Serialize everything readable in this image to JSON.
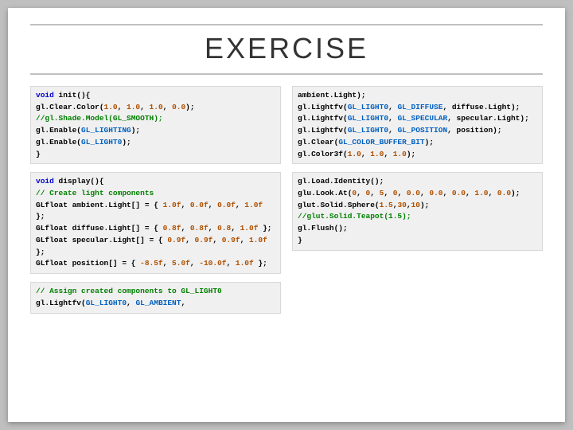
{
  "title": "EXERCISE",
  "code_left_1": {
    "l1a": "void",
    "l1b": " init(){",
    "l2a": "gl.Clear.Color(",
    "l2b": "1.0",
    "l2c": ", ",
    "l2d": "1.0",
    "l2e": ", ",
    "l2f": "1.0",
    "l2g": ", ",
    "l2h": "0.0",
    "l2i": ");",
    "l3": "//gl.Shade.Model(GL_SMOOTH);",
    "l4a": "gl.Enable(",
    "l4b": "GL_LIGHTING",
    "l4c": ");",
    "l5a": "gl.Enable(",
    "l5b": "GL_LIGHT0",
    "l5c": ");",
    "l6": "}"
  },
  "code_left_2": {
    "l1a": "void",
    "l1b": " display(){",
    "l2": "// Create light components",
    "l3a": "GLfloat ambient.Light[] = { ",
    "l3b": "1.0f",
    "l3c": ", ",
    "l3d": "0.0f",
    "l3e": ", ",
    "l3f": "0.0f",
    "l3g": ", ",
    "l3h": "1.0f",
    "l3i": " };",
    "l4a": "GLfloat diffuse.Light[] = { ",
    "l4b": "0.8f",
    "l4c": ", ",
    "l4d": "0.8f",
    "l4e": ", ",
    "l4f": "0.8",
    "l4g": ", ",
    "l4h": "1.0f",
    "l4i": " };",
    "l5a": "GLfloat specular.Light[] = { ",
    "l5b": "0.9f",
    "l5c": ", ",
    "l5d": "0.9f",
    "l5e": ", ",
    "l5f": "0.9f",
    "l5g": ", ",
    "l5h": "1.0f",
    "l5i": " };",
    "l6a": "GLfloat position[] = { ",
    "l6b": "-8.5f",
    "l6c": ", ",
    "l6d": "5.0f",
    "l6e": ", ",
    "l6f": "-10.0f",
    "l6g": ", ",
    "l6h": "1.0f",
    "l6i": " };"
  },
  "code_left_3": {
    "l1": "// Assign created components to GL_LIGHT0",
    "l2a": "gl.Lightfv(",
    "l2b": "GL_LIGHT0",
    "l2c": ", ",
    "l2d": "GL_AMBIENT",
    "l2e": ","
  },
  "code_right_1": {
    "l1": "ambient.Light);",
    "l2a": "gl.Lightfv(",
    "l2b": "GL_LIGHT0",
    "l2c": ", ",
    "l2d": "GL_DIFFUSE",
    "l2e": ", diffuse.Light);",
    "l3a": "gl.Lightfv(",
    "l3b": "GL_LIGHT0",
    "l3c": ", ",
    "l3d": "GL_SPECULAR",
    "l3e": ", specular.Light);",
    "l4a": "gl.Lightfv(",
    "l4b": "GL_LIGHT0",
    "l4c": ", ",
    "l4d": "GL_POSITION",
    "l4e": ", position);",
    "l5a": "gl.Clear(",
    "l5b": "GL_COLOR_BUFFER_BIT",
    "l5c": ");",
    "l6a": "gl.Color3f(",
    "l6b": "1.0",
    "l6c": ", ",
    "l6d": "1.0",
    "l6e": ", ",
    "l6f": "1.0",
    "l6g": ");"
  },
  "code_right_2": {
    "l1": "gl.Load.Identity();",
    "l2a": "glu.Look.At(",
    "l2b": "0",
    "l2c": ", ",
    "l2d": "0",
    "l2e": ", ",
    "l2f": "5",
    "l2g": ", ",
    "l2h": "0",
    "l2i": ", ",
    "l2j": "0.0",
    "l2k": ", ",
    "l2l": "0.0",
    "l2m": ", ",
    "l2n": "0.0",
    "l2o": ", ",
    "l2p": "1.0",
    "l2q": ", ",
    "l2r": "0.0",
    "l2s": ");",
    "l3a": "glut.Solid.Sphere(",
    "l3b": "1.5",
    "l3c": ",",
    "l3d": "30",
    "l3e": ",",
    "l3f": "10",
    "l3g": ");",
    "l4": "//glut.Solid.Teapot(1.5);",
    "l5": "gl.Flush();",
    "l6": "}"
  }
}
